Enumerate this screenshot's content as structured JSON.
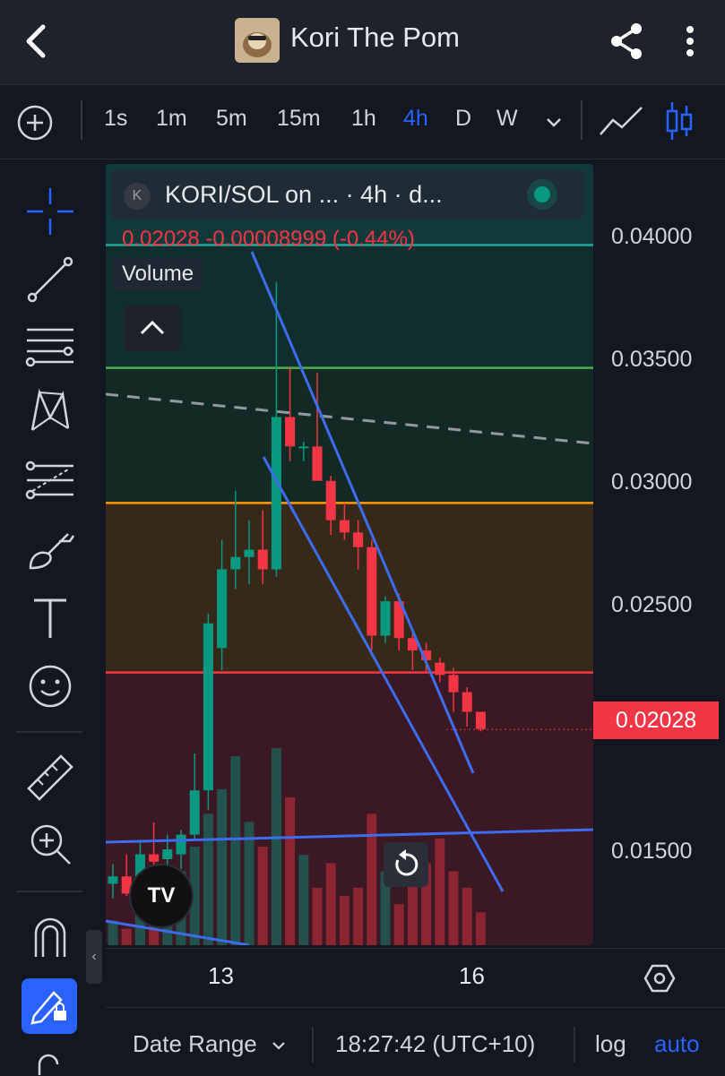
{
  "header": {
    "title": "Kori The Pom"
  },
  "timeframes": [
    "1s",
    "1m",
    "5m",
    "15m",
    "1h",
    "4h",
    "D",
    "W"
  ],
  "active_timeframe": "4h",
  "legend": {
    "icon_letter": "K",
    "symbol_text": "KORI/SOL on ... · 4h · d...",
    "ohlc_text": "0.02028  -0.00008999 (-0.44%)",
    "volume_label": "Volume"
  },
  "price_axis": {
    "ticks": [
      "0.04000",
      "0.03500",
      "0.03000",
      "0.02500",
      "0.01500"
    ],
    "current_price": "0.02028"
  },
  "time_axis": {
    "ticks": [
      "13",
      "16"
    ]
  },
  "bottom_bar": {
    "date_range": "Date Range",
    "clock": "18:27:42 (UTC+10)",
    "log": "log",
    "auto": "auto"
  },
  "logo_text": "TV",
  "colors": {
    "up": "#089981",
    "down": "#f23645",
    "accent": "#2962ff",
    "fib_green": "#4caf50",
    "fib_orange": "#ff9800",
    "fib_red": "#f23645"
  },
  "chart_data": {
    "type": "candlestick",
    "ylim": [
      0.0115,
      0.0433
    ],
    "levels": [
      0.04,
      0.035,
      0.0295,
      0.0226
    ],
    "candles": [
      {
        "o": 0.014,
        "h": 0.0148,
        "l": 0.0134,
        "c": 0.0143
      },
      {
        "o": 0.0143,
        "h": 0.0152,
        "l": 0.0135,
        "c": 0.0136
      },
      {
        "o": 0.0135,
        "h": 0.0158,
        "l": 0.013,
        "c": 0.0152
      },
      {
        "o": 0.0152,
        "h": 0.0165,
        "l": 0.0145,
        "c": 0.0149
      },
      {
        "o": 0.015,
        "h": 0.016,
        "l": 0.0148,
        "c": 0.0154
      },
      {
        "o": 0.0152,
        "h": 0.0162,
        "l": 0.0146,
        "c": 0.016
      },
      {
        "o": 0.016,
        "h": 0.0193,
        "l": 0.0158,
        "c": 0.0178
      },
      {
        "o": 0.0178,
        "h": 0.025,
        "l": 0.017,
        "c": 0.0246
      },
      {
        "o": 0.0236,
        "h": 0.028,
        "l": 0.0227,
        "c": 0.0268
      },
      {
        "o": 0.0268,
        "h": 0.03,
        "l": 0.026,
        "c": 0.0273
      },
      {
        "o": 0.0273,
        "h": 0.0288,
        "l": 0.0262,
        "c": 0.0276
      },
      {
        "o": 0.0276,
        "h": 0.0292,
        "l": 0.0262,
        "c": 0.0268
      },
      {
        "o": 0.0268,
        "h": 0.0385,
        "l": 0.0265,
        "c": 0.033
      },
      {
        "o": 0.033,
        "h": 0.035,
        "l": 0.0312,
        "c": 0.0318
      },
      {
        "o": 0.0318,
        "h": 0.032,
        "l": 0.0312,
        "c": 0.0318
      },
      {
        "o": 0.0318,
        "h": 0.0348,
        "l": 0.031,
        "c": 0.0304
      },
      {
        "o": 0.0304,
        "h": 0.0306,
        "l": 0.0282,
        "c": 0.0288
      },
      {
        "o": 0.0288,
        "h": 0.0295,
        "l": 0.028,
        "c": 0.0283
      },
      {
        "o": 0.0283,
        "h": 0.0288,
        "l": 0.0268,
        "c": 0.0277
      },
      {
        "o": 0.0277,
        "h": 0.028,
        "l": 0.0235,
        "c": 0.0241
      },
      {
        "o": 0.0241,
        "h": 0.0257,
        "l": 0.0238,
        "c": 0.0255
      },
      {
        "o": 0.0255,
        "h": 0.0258,
        "l": 0.0235,
        "c": 0.024
      },
      {
        "o": 0.024,
        "h": 0.0242,
        "l": 0.0227,
        "c": 0.0235
      },
      {
        "o": 0.0235,
        "h": 0.0238,
        "l": 0.0226,
        "c": 0.0231
      },
      {
        "o": 0.023,
        "h": 0.0232,
        "l": 0.0222,
        "c": 0.0225
      },
      {
        "o": 0.0225,
        "h": 0.0228,
        "l": 0.021,
        "c": 0.0218
      },
      {
        "o": 0.0218,
        "h": 0.022,
        "l": 0.0204,
        "c": 0.021
      },
      {
        "o": 0.021,
        "h": 0.021,
        "l": 0.0202,
        "c": 0.0203
      }
    ],
    "volumes": [
      30,
      20,
      45,
      40,
      80,
      90,
      120,
      160,
      190,
      230,
      150,
      120,
      240,
      180,
      110,
      70,
      100,
      60,
      70,
      160,
      90,
      50,
      80,
      100,
      130,
      90,
      70,
      40
    ]
  }
}
